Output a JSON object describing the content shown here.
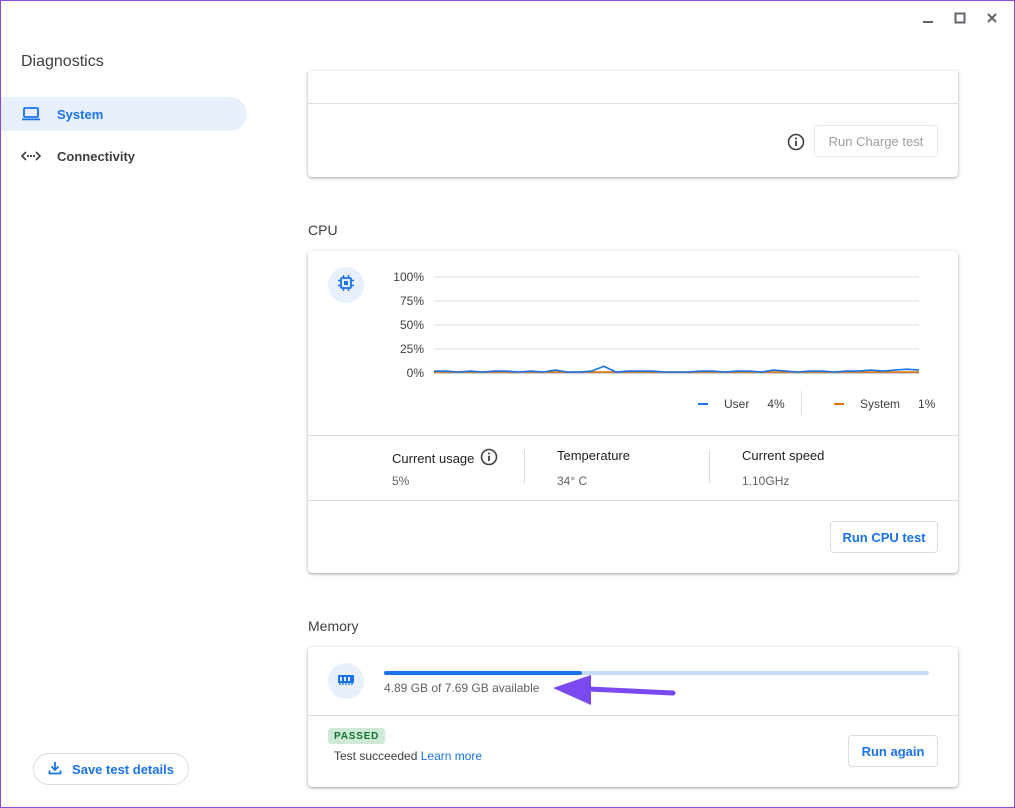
{
  "app": {
    "title": "Diagnostics"
  },
  "window_controls": {
    "minimize": "minimize",
    "maximize": "maximize",
    "close": "close"
  },
  "sidebar": {
    "items": [
      {
        "label": "System",
        "icon": "laptop-icon",
        "active": true
      },
      {
        "label": "Connectivity",
        "icon": "connectivity-icon",
        "active": false
      }
    ],
    "save_label": "Save test details"
  },
  "battery": {
    "run_label": "Run Charge test"
  },
  "cpu": {
    "title": "CPU",
    "stats": {
      "usage_label": "Current usage",
      "usage_value": "5%",
      "temp_label": "Temperature",
      "temp_value": "34° C",
      "speed_label": "Current speed",
      "speed_value": "1.10GHz"
    },
    "run_label": "Run CPU test"
  },
  "chart_data": {
    "type": "line",
    "title": "",
    "xlabel": "",
    "ylabel": "",
    "ylim": [
      0,
      100
    ],
    "yticks": [
      "100%",
      "75%",
      "50%",
      "25%",
      "0%"
    ],
    "legend_position": "bottom-right",
    "series": [
      {
        "name": "User",
        "value_label": "4%",
        "color": "#1a73e8",
        "values": [
          2,
          2,
          1,
          2,
          1,
          2,
          2,
          1,
          2,
          1,
          3,
          1,
          1,
          2,
          7,
          1,
          2,
          2,
          2,
          1,
          1,
          1,
          2,
          2,
          1,
          2,
          2,
          1,
          3,
          2,
          1,
          2,
          2,
          1,
          2,
          2,
          3,
          2,
          3,
          4,
          3
        ]
      },
      {
        "name": "System",
        "value_label": "1%",
        "color": "#e37400",
        "values": [
          1,
          1,
          1,
          1,
          1,
          1,
          1,
          1,
          1,
          1,
          1,
          1,
          1,
          1,
          1,
          1,
          1,
          1,
          1,
          1,
          1,
          1,
          1,
          1,
          1,
          1,
          1,
          1,
          1,
          1,
          1,
          1,
          1,
          1,
          1,
          1,
          1,
          1,
          1,
          1,
          1
        ]
      }
    ]
  },
  "memory": {
    "title": "Memory",
    "available_text": "4.89 GB of 7.69 GB available",
    "used_fraction": 0.364,
    "badge": "PASSED",
    "status_text": "Test succeeded",
    "learn_more": "Learn more",
    "run_label": "Run again"
  },
  "colors": {
    "accent": "#1a73e8",
    "annotation": "#7a4af0"
  }
}
